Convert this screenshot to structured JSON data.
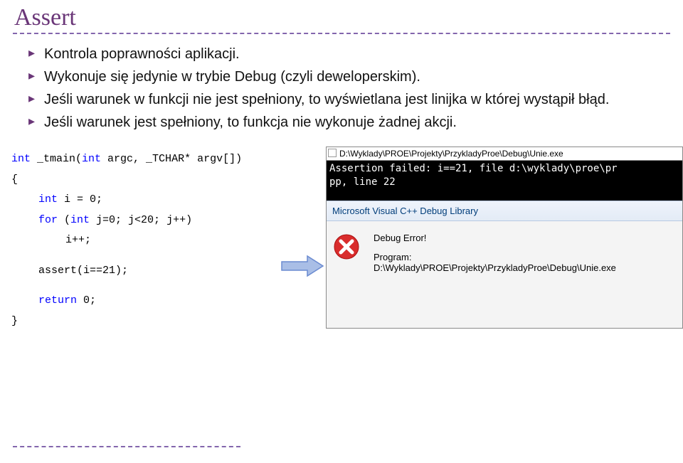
{
  "title": "Assert",
  "bullets": [
    "Kontrola poprawności aplikacji.",
    "Wykonuje się jedynie w trybie Debug (czyli deweloperskim).",
    "Jeśli warunek w funkcji nie jest spełniony, to wyświetlana jest linijka w której wystąpił błąd.",
    "Jeśli warunek jest spełniony, to funkcja nie wykonuje żadnej akcji."
  ],
  "code": {
    "l1a": "int",
    "l1b": " _tmain(",
    "l1c": "int",
    "l1d": " argc, _TCHAR* argv[])",
    "l2": "{",
    "l3a": "int",
    "l3b": " i = 0;",
    "l4a": "for",
    "l4b": " (",
    "l4c": "int",
    "l4d": " j=0; j<20; j++)",
    "l5": "i++;",
    "l6": "assert(i==21);",
    "l7a": "return",
    "l7b": " 0;",
    "l8": "}"
  },
  "console": {
    "title": "D:\\Wyklady\\PROE\\Projekty\\PrzykladyProe\\Debug\\Unie.exe",
    "line1": "Assertion failed: i==21, file d:\\wyklady\\proe\\pr",
    "line2": "pp, line 22"
  },
  "msgbox": {
    "title": "Microsoft Visual C++ Debug Library",
    "heading": "Debug Error!",
    "program_label": "Program:",
    "program_path": "D:\\Wyklady\\PROE\\Projekty\\PrzykladyProe\\Debug\\Unie.exe"
  },
  "icon": {
    "red": "#d92c2c",
    "white": "#ffffff"
  },
  "arrow_color": "#6b8bd1"
}
